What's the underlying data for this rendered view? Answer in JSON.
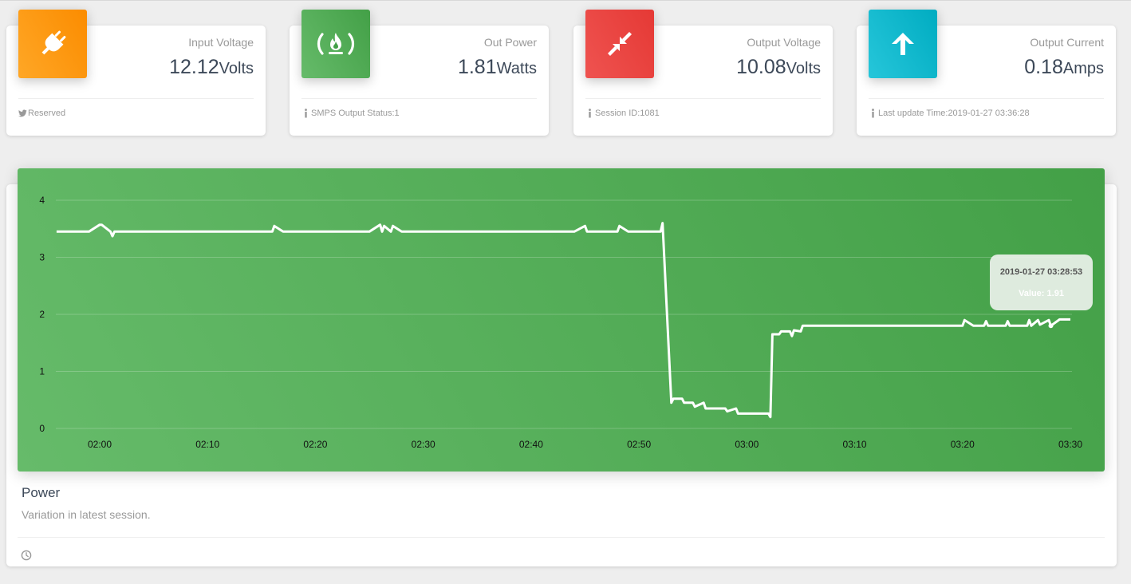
{
  "stats": [
    {
      "title": "Input Voltage",
      "value": "12.12",
      "unit": "Volts",
      "footer": "Reserved",
      "icon": "plug-icon",
      "footer_icon": "twitter-icon",
      "color": "#fb8c00"
    },
    {
      "title": "Out Power",
      "value": "1.81",
      "unit": "Watts",
      "footer": "SMPS Output Status:1",
      "icon": "fire-icon",
      "footer_icon": "info-icon",
      "color": "#43a047"
    },
    {
      "title": "Output Voltage",
      "value": "10.08",
      "unit": "Volts",
      "footer": "Session ID:1081",
      "icon": "compress-icon",
      "footer_icon": "info-icon",
      "color": "#e53935"
    },
    {
      "title": "Output Current",
      "value": "0.18",
      "unit": "Amps",
      "footer": "Last update Time:2019-01-27 03:36:28",
      "icon": "arrow-up-icon",
      "footer_icon": "info-icon",
      "color": "#00acc1"
    }
  ],
  "chart_card": {
    "title": "Power",
    "subtitle": "Variation in latest session.",
    "footer_icon": "clock-icon"
  },
  "tooltip": {
    "date": "2019-01-27 03:28:53",
    "value": "Value: 1.91"
  },
  "chart_data": {
    "type": "line",
    "title": "",
    "xlabel": "",
    "ylabel": "",
    "ylim": [
      0,
      4
    ],
    "yticks": [
      "0",
      "1",
      "2",
      "3",
      "4"
    ],
    "xticks": [
      "02:00",
      "02:10",
      "02:20",
      "02:30",
      "02:40",
      "02:50",
      "03:00",
      "03:10",
      "03:20",
      "03:30"
    ],
    "grid": true,
    "line_color": "#ffffff",
    "series": [
      {
        "name": "",
        "points": [
          [
            "01:56",
            3.45
          ],
          [
            "01:59",
            3.45
          ],
          [
            "02:00",
            3.57
          ],
          [
            "02:00",
            3.57
          ],
          [
            "02:01",
            3.45
          ],
          [
            "02:01",
            3.37
          ],
          [
            "02:01",
            3.45
          ],
          [
            "02:16",
            3.45
          ],
          [
            "02:16",
            3.55
          ],
          [
            "02:17",
            3.45
          ],
          [
            "02:25",
            3.45
          ],
          [
            "02:26",
            3.57
          ],
          [
            "02:26",
            3.45
          ],
          [
            "02:26",
            3.55
          ],
          [
            "02:27",
            3.45
          ],
          [
            "02:27",
            3.55
          ],
          [
            "02:28",
            3.45
          ],
          [
            "02:44",
            3.45
          ],
          [
            "02:45",
            3.55
          ],
          [
            "02:45",
            3.45
          ],
          [
            "02:48",
            3.45
          ],
          [
            "02:48",
            3.55
          ],
          [
            "02:49",
            3.45
          ],
          [
            "02:52",
            3.45
          ],
          [
            "02:52",
            3.6
          ],
          [
            "02:53",
            0.45
          ],
          [
            "02:53",
            0.52
          ],
          [
            "02:54",
            0.52
          ],
          [
            "02:54",
            0.45
          ],
          [
            "02:55",
            0.45
          ],
          [
            "02:55",
            0.38
          ],
          [
            "02:56",
            0.45
          ],
          [
            "02:56",
            0.35
          ],
          [
            "02:58",
            0.35
          ],
          [
            "02:58",
            0.3
          ],
          [
            "02:59",
            0.35
          ],
          [
            "02:59",
            0.26
          ],
          [
            "03:02",
            0.26
          ],
          [
            "03:02",
            0.2
          ],
          [
            "03:02",
            1.65
          ],
          [
            "03:03",
            1.65
          ],
          [
            "03:03",
            1.7
          ],
          [
            "03:04",
            1.7
          ],
          [
            "03:04",
            1.62
          ],
          [
            "03:04",
            1.72
          ],
          [
            "03:05",
            1.7
          ],
          [
            "03:05",
            1.8
          ],
          [
            "03:20",
            1.8
          ],
          [
            "03:20",
            1.9
          ],
          [
            "03:21",
            1.8
          ],
          [
            "03:22",
            1.8
          ],
          [
            "03:22",
            1.88
          ],
          [
            "03:22",
            1.8
          ],
          [
            "03:24",
            1.8
          ],
          [
            "03:24",
            1.88
          ],
          [
            "03:24",
            1.8
          ],
          [
            "03:26",
            1.8
          ],
          [
            "03:26",
            1.9
          ],
          [
            "03:26",
            1.8
          ],
          [
            "03:27",
            1.9
          ],
          [
            "03:27",
            1.82
          ],
          [
            "03:28",
            1.9
          ],
          [
            "03:28",
            1.8
          ],
          [
            "03:29",
            1.91
          ],
          [
            "03:30",
            1.91
          ]
        ]
      }
    ]
  }
}
